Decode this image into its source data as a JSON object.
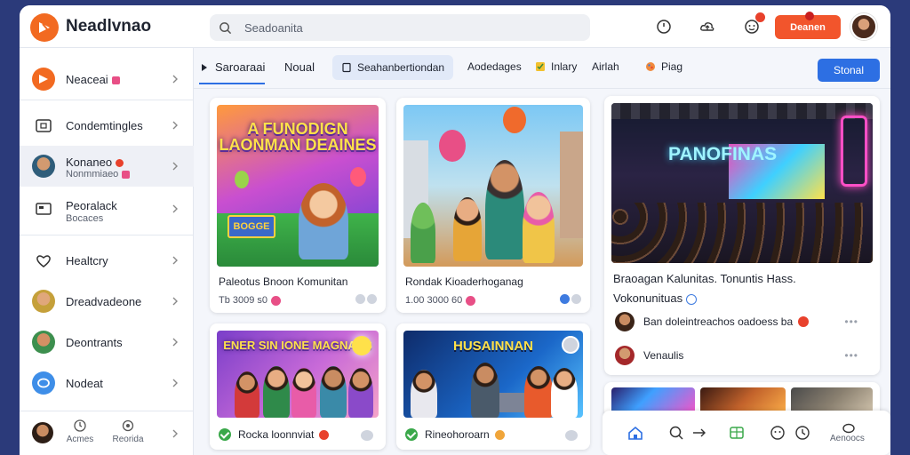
{
  "app": {
    "brand": "Neadlvnao"
  },
  "search": {
    "placeholder": "Seadoanita"
  },
  "header": {
    "cta_label": "Deanen"
  },
  "sidebar": {
    "items": [
      {
        "label": "Neaceai",
        "icon": "app-logo-icon"
      },
      {
        "label": "Condemtingles",
        "icon": "folder-icon"
      },
      {
        "label": "Konaneo",
        "sub": "Nonmmiaeo",
        "icon": "user-avatar-icon"
      },
      {
        "label": "Peoralack",
        "sub": "Bocaces",
        "icon": "screen-icon"
      },
      {
        "label": "Healtcry",
        "icon": "heart-icon"
      },
      {
        "label": "Dreadvadeone",
        "icon": "user-avatar-icon"
      },
      {
        "label": "Deontrants",
        "icon": "user-avatar-icon"
      },
      {
        "label": "Nodeat",
        "icon": "chat-icon"
      }
    ],
    "footer": [
      {
        "label": "Acmes",
        "icon": "clock-icon"
      },
      {
        "label": "Reorida",
        "icon": "settings-icon"
      }
    ]
  },
  "tabs": [
    {
      "label": "Saroaraai"
    },
    {
      "label": "Noual"
    },
    {
      "label": "Seahanbertiondan"
    },
    {
      "label": "Aodedages"
    },
    {
      "label": "Inlary"
    },
    {
      "label": "Airlah"
    },
    {
      "label": "Piag"
    }
  ],
  "new_button": "Stonal",
  "cards": [
    {
      "thumb_title": "A FUNODIGN LAONMAN DEAINES",
      "thumb_sign": "BOGGE",
      "title": "Paleotus Bnoon Komunitan",
      "meta": "Tb 3009 s0"
    },
    {
      "thumb_title": "",
      "thumb_sign": "",
      "title": "Rondak Kioaderhoganag",
      "meta": "1.00 3000 60"
    },
    {
      "thumb_title": "ENER SIN IONE MAGNABS",
      "title": "Rocka loonnviat",
      "meta": ""
    },
    {
      "thumb_title": "HUSAINNAN",
      "title": "Rineohoroarn",
      "meta": ""
    }
  ],
  "feature": {
    "sign": "PANOFINAS",
    "title": "Braoagan Kalunitas. Tonuntis Hass.",
    "subtitle": "Vokonunituas",
    "comments": [
      {
        "text": "Ban doleintreachos oadoess ba"
      },
      {
        "text": "Venaulis"
      }
    ]
  },
  "dock": {
    "label": "Aenoocs"
  },
  "colors": {
    "accent": "#2d6fe3",
    "brand": "#f26a21",
    "cta": "#f2552c",
    "badge": "#e8412c"
  }
}
